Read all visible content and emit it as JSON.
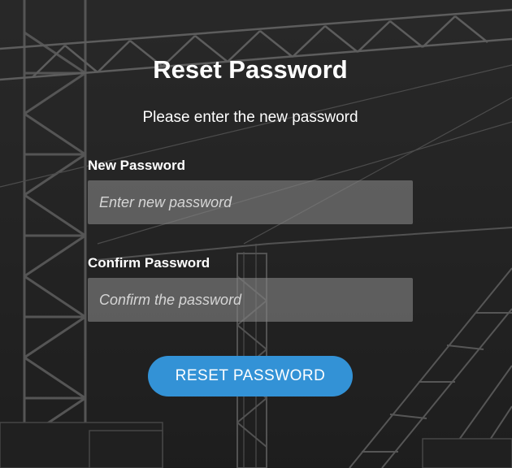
{
  "page": {
    "title": "Reset Password",
    "subtitle": "Please enter the new password"
  },
  "form": {
    "new_password": {
      "label": "New Password",
      "placeholder": "Enter new password",
      "value": ""
    },
    "confirm_password": {
      "label": "Confirm Password",
      "placeholder": "Confirm the password",
      "value": ""
    },
    "submit_label": "RESET PASSWORD"
  },
  "colors": {
    "accent": "#3392d6",
    "text": "#ffffff",
    "input_bg": "#828282"
  }
}
